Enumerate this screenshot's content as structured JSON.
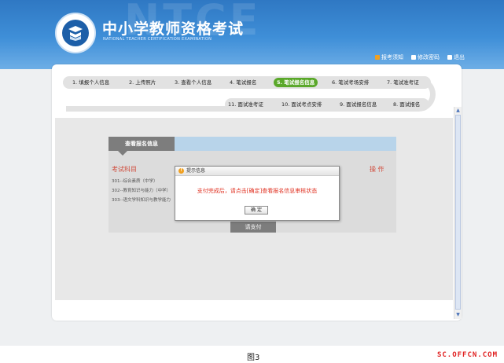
{
  "header": {
    "title": "中小学教师资格考试",
    "subtitle": "NATIONAL TEACHER CERTIFICATION EXAMINATION",
    "watermark": "NTCE",
    "links": [
      {
        "label": "报考须知",
        "icon": "info-icon",
        "color": "#f0a020"
      },
      {
        "label": "修改密码",
        "icon": "key-icon",
        "color": "#ffffff"
      },
      {
        "label": "退出",
        "icon": "exit-icon",
        "color": "#ffffff"
      }
    ]
  },
  "steps": {
    "row1": [
      "1. 填报个人信息",
      "2. 上传照片",
      "3. 查看个人信息",
      "4. 笔试报名",
      "5. 笔试报名信息",
      "6. 笔试考场安排",
      "7. 笔试准考证"
    ],
    "row2": [
      "11. 面试准考证",
      "10. 面试考点安排",
      "9. 面试报名信息",
      "8. 面试报名"
    ],
    "active": "5. 笔试报名信息",
    "active_color": "#5aa82a"
  },
  "card": {
    "tab_label": "查看报名信息",
    "col_subject": "考试科目",
    "col_action": "操 作",
    "subjects": [
      "301--综合素质（中学）",
      "302--教育知识与能力（中学）",
      "303--语文学科知识与教学能力"
    ],
    "pay_button": "请支付"
  },
  "dialog": {
    "title": "提示信息",
    "message": "支付完成后，请点击[确定]查看报名信息审核状态",
    "ok_label": "确 定"
  },
  "caption": "图3",
  "site_mark": "SC.OFFCN.COM",
  "colors": {
    "header_blue": "#3f8fd8",
    "accent_red": "#e03020",
    "active_green": "#5aa82a"
  }
}
